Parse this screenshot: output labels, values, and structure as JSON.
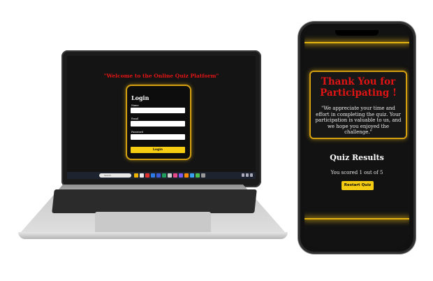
{
  "laptop": {
    "welcome": "\"Welcome to the Online Quiz Platform\"",
    "login": {
      "title": "Login",
      "name_label": "Name",
      "email_label": "Email",
      "password_label": "Password",
      "button": "Login"
    },
    "taskbar": {
      "search_placeholder": "Search",
      "app_icon_colors": [
        "#f0b400",
        "#e8e8e8",
        "#e03030",
        "#2e7be8",
        "#3b5bd6",
        "#1e9e5a",
        "#d0d0d0",
        "#e84a8a",
        "#7a5af0",
        "#ff8a00",
        "#3aa0f0",
        "#4ac04a",
        "#999999"
      ]
    }
  },
  "phone": {
    "thank_title": "Thank You for Participating !",
    "thank_message": "\"We appreciate your time and effort in completing the quiz. Your participation is valuable to us, and we hope you enjoyed the challenge.\"",
    "results_title": "Quiz Results",
    "score_text": "You scored 1 out of 5",
    "restart_button": "Restart Quiz"
  },
  "colors": {
    "accent_gold": "#f5cc12",
    "title_red": "#e01414",
    "screen_bg": "#141414"
  }
}
